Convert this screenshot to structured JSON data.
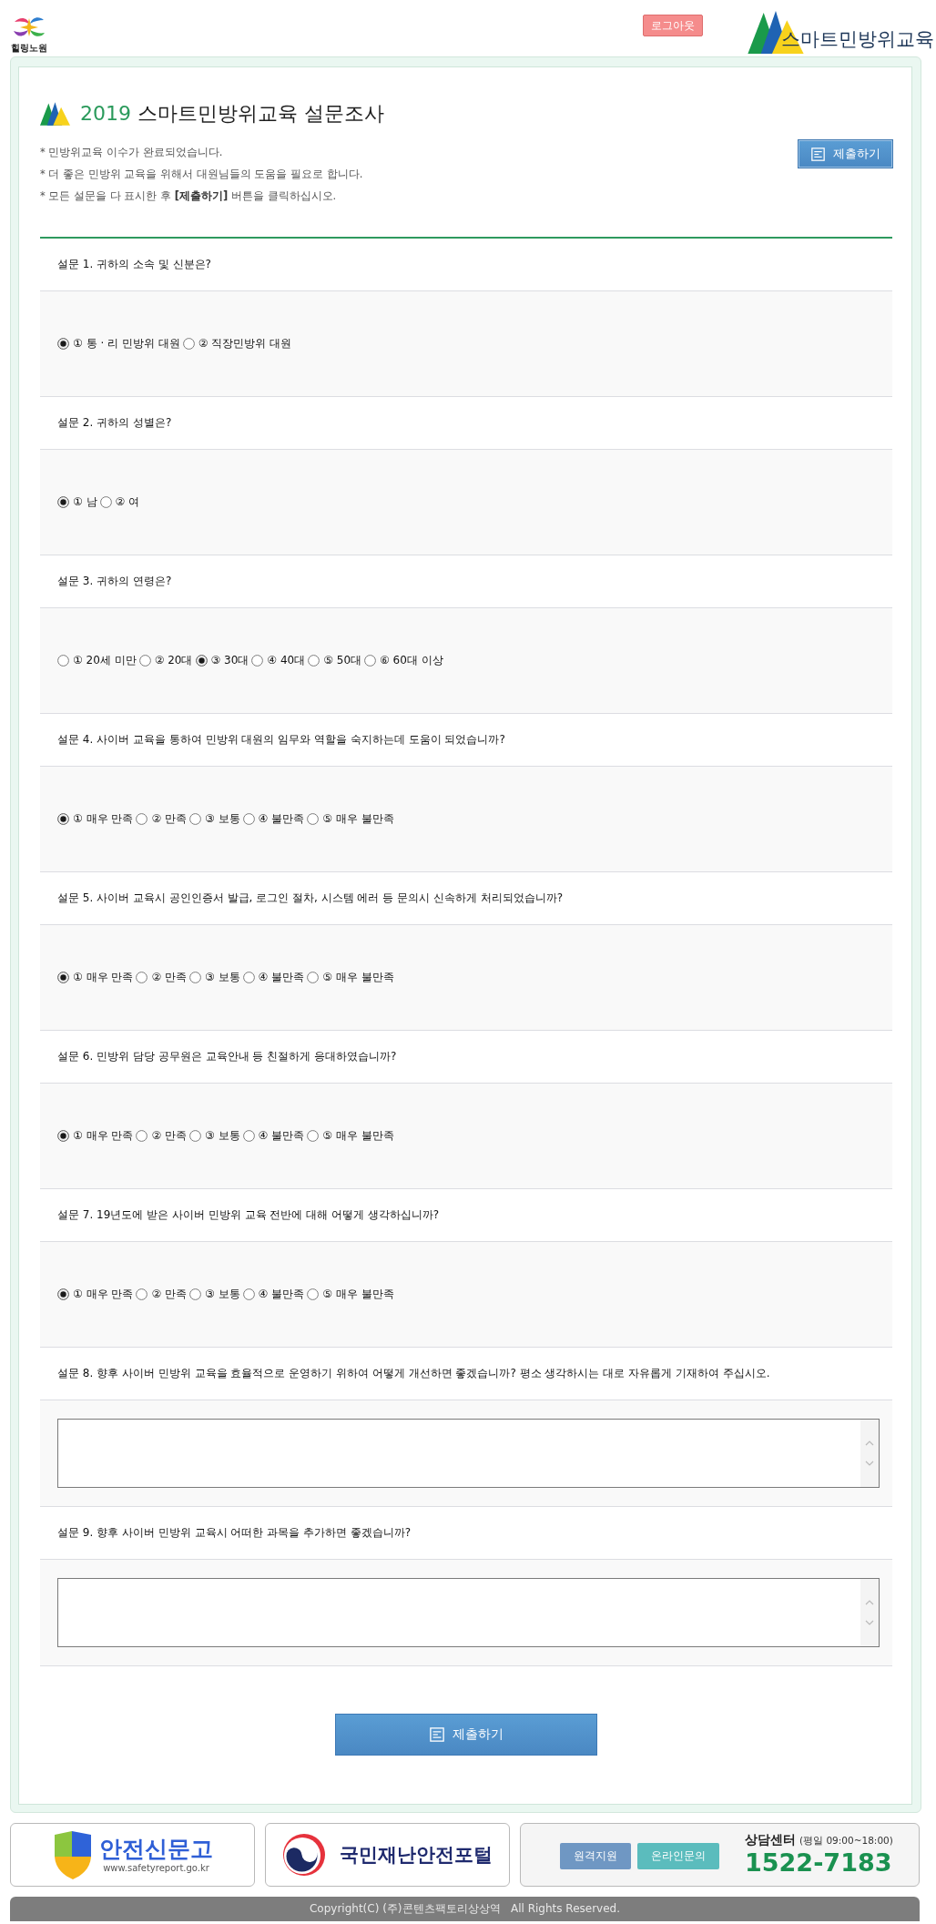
{
  "header": {
    "logo_text": "힐링노원",
    "logout_button": "로그아웃",
    "brand_name": "스마트민방위교육"
  },
  "survey": {
    "title_year": "2019",
    "title": "스마트민방위교육 설문조사",
    "notes": [
      "* 민방위교육 이수가 완료되었습니다.",
      "* 더 좋은 민방위 교육을 위해서 대원님들의 도움을 필요로 합니다.",
      "* 모든 설문을 다 표시한 후 **[제출하기]** 버튼을 클릭하십시오."
    ],
    "submit_button": "제출하기",
    "questions": [
      {
        "kind": "choice",
        "text": "설문 1. 귀하의 소속 및 신분은?",
        "options": [
          {
            "label": "① 통 · 리 민방위 대원",
            "selected": true
          },
          {
            "label": "② 직장민방위 대원",
            "selected": false
          }
        ]
      },
      {
        "kind": "choice",
        "text": "설문 2. 귀하의 성별은?",
        "options": [
          {
            "label": "① 남",
            "selected": true
          },
          {
            "label": "② 여",
            "selected": false
          }
        ]
      },
      {
        "kind": "choice",
        "text": "설문 3. 귀하의 연령은?",
        "options": [
          {
            "label": "① 20세 미만",
            "selected": false
          },
          {
            "label": "② 20대",
            "selected": false
          },
          {
            "label": "③ 30대",
            "selected": true
          },
          {
            "label": "④ 40대",
            "selected": false
          },
          {
            "label": "⑤ 50대",
            "selected": false
          },
          {
            "label": "⑥ 60대 이상",
            "selected": false
          }
        ]
      },
      {
        "kind": "choice",
        "text": "설문 4. 사이버 교육을 통하여 민방위 대원의 임무와 역할을 숙지하는데 도움이 되었습니까?",
        "options": [
          {
            "label": "① 매우 만족",
            "selected": true
          },
          {
            "label": "② 만족",
            "selected": false
          },
          {
            "label": "③ 보통",
            "selected": false
          },
          {
            "label": "④ 불만족",
            "selected": false
          },
          {
            "label": "⑤ 매우 불만족",
            "selected": false
          }
        ]
      },
      {
        "kind": "choice",
        "text": "설문 5. 사이버 교육시 공인인증서 발급, 로그인 절차, 시스템 에러 등 문의시 신속하게 처리되었습니까?",
        "options": [
          {
            "label": "① 매우 만족",
            "selected": true
          },
          {
            "label": "② 만족",
            "selected": false
          },
          {
            "label": "③ 보통",
            "selected": false
          },
          {
            "label": "④ 불만족",
            "selected": false
          },
          {
            "label": "⑤ 매우 불만족",
            "selected": false
          }
        ]
      },
      {
        "kind": "choice",
        "text": "설문 6. 민방위 담당 공무원은 교육안내 등 친절하게 응대하였습니까?",
        "options": [
          {
            "label": "① 매우 만족",
            "selected": true
          },
          {
            "label": "② 만족",
            "selected": false
          },
          {
            "label": "③ 보통",
            "selected": false
          },
          {
            "label": "④ 불만족",
            "selected": false
          },
          {
            "label": "⑤ 매우 불만족",
            "selected": false
          }
        ]
      },
      {
        "kind": "choice",
        "text": "설문 7. 19년도에 받은 사이버 민방위 교육 전반에 대해 어떻게 생각하십니까?",
        "options": [
          {
            "label": "① 매우 만족",
            "selected": true
          },
          {
            "label": "② 만족",
            "selected": false
          },
          {
            "label": "③ 보통",
            "selected": false
          },
          {
            "label": "④ 불만족",
            "selected": false
          },
          {
            "label": "⑤ 매우 불만족",
            "selected": false
          }
        ]
      },
      {
        "kind": "text",
        "text": "설문 8. 향후 사이버 민방위 교육을 효율적으로 운영하기 위하여 어떻게 개선하면 좋겠습니까? 평소 생각하시는 대로 자유롭게 기재하여 주십시오."
      },
      {
        "kind": "text",
        "text": "설문 9. 향후 사이버 민방위 교육시 어떠한 과목을 추가하면 좋겠습니까?"
      }
    ],
    "bottom_submit_button": "제출하기"
  },
  "footer": {
    "partners": [
      {
        "kind": "report",
        "name": "안전신문고",
        "url": "www.safetyreport.go.kr"
      },
      {
        "kind": "portal",
        "name": "국민재난안전포털"
      }
    ],
    "support_buttons": [
      {
        "label": "원격지원",
        "color": "#6f97c3"
      },
      {
        "label": "온라인문의",
        "color": "#5bbcbd"
      }
    ],
    "call_center": {
      "label": "상담센터",
      "hours": "(평일 09:00~18:00)",
      "phone": "1522-7183"
    },
    "copyright": "Copyright(C) (주)콘텐츠팩토리상상역   All Rights Reserved."
  }
}
